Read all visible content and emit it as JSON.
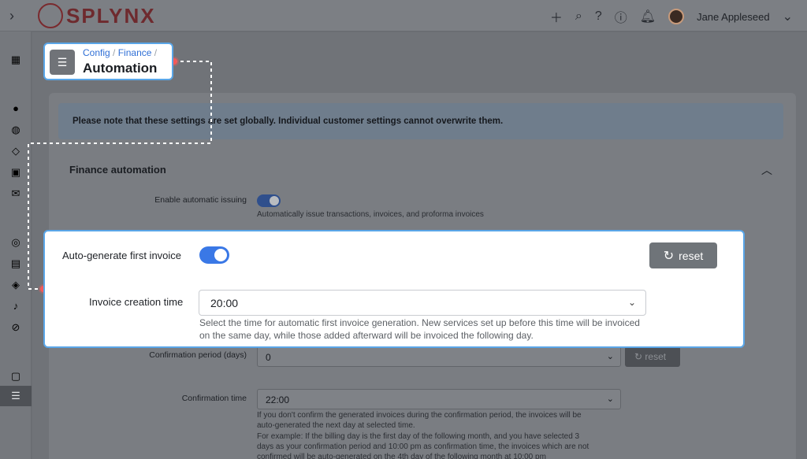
{
  "topbar": {
    "logo_text": "SPLYNX",
    "user_name": "Jane Appleseed",
    "icons": [
      "menu-expand-icon",
      "plus-icon",
      "search-icon",
      "help-icon",
      "info-icon",
      "bell-icon"
    ]
  },
  "sidebar": {
    "icons": [
      "dashboard-icon",
      "customers-icon",
      "tickets-icon",
      "tariffs-icon",
      "finance-icon",
      "messages-icon",
      "networking-icon",
      "scheduling-icon",
      "inventory-icon",
      "voice-icon",
      "administration-icon",
      "company-icon",
      "config-icon"
    ]
  },
  "breadcrumb": {
    "path": [
      "Config",
      "Finance"
    ],
    "separator": "/",
    "title": "Automation"
  },
  "notice": "Please note that these settings are set globally. Individual customer settings cannot overwrite them.",
  "section": {
    "title": "Finance automation",
    "enable_issuing": {
      "label": "Enable automatic issuing",
      "hint": "Automatically issue transactions, invoices, and proforma invoices",
      "enabled": true
    },
    "confirmation_period": {
      "label": "Confirmation period (days)",
      "value": "0",
      "reset_label": "reset"
    },
    "confirmation_time": {
      "label": "Confirmation time",
      "value": "22:00",
      "hint_lines": [
        "If you don't confirm the generated invoices during the confirmation period, the invoices will be",
        "auto-generated the next day at selected time.",
        "For example: If the billing day is the first day of the following month, and you have selected 3",
        "days as your confirmation period and 10:00 pm as confirmation time, the invoices which are not",
        "confirmed will be auto-generated on the 4th day of the following month at 10:00 pm"
      ]
    }
  },
  "focus": {
    "auto_first_invoice": {
      "label": "Auto-generate first invoice",
      "enabled": true
    },
    "reset_label": "reset",
    "creation_time": {
      "label": "Invoice creation time",
      "value": "20:00",
      "hint": "Select the time for automatic first invoice generation. New services set up before this time will be invoiced on the same day, while those added afterward will be invoiced the following day."
    }
  },
  "colors": {
    "accent": "#3a78e6",
    "highlight_border": "#5aa6e8",
    "connector_dot": "#f25a5a",
    "link": "#2f6fd6"
  }
}
